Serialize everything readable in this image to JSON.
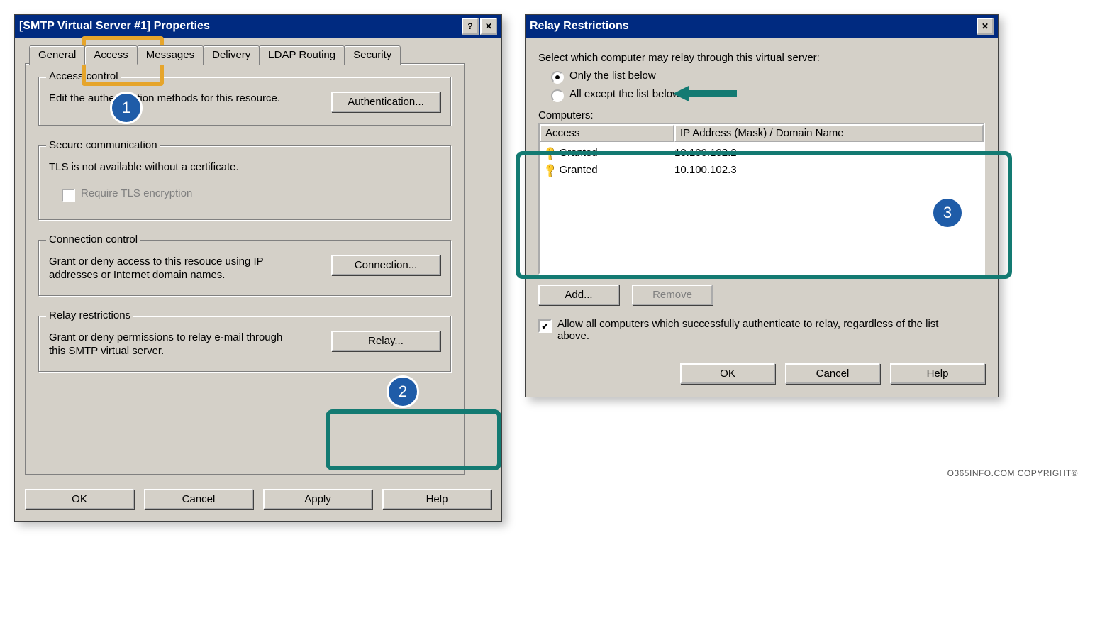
{
  "left": {
    "title": "[SMTP Virtual Server #1] Properties",
    "tabs": [
      "General",
      "Access",
      "Messages",
      "Delivery",
      "LDAP Routing",
      "Security"
    ],
    "access_control": {
      "legend": "Access control",
      "desc": "Edit the authentication methods for this resource.",
      "btn": "Authentication..."
    },
    "secure_comm": {
      "legend": "Secure communication",
      "desc": "TLS is not available without a certificate.",
      "chk": "Require TLS encryption"
    },
    "conn_control": {
      "legend": "Connection control",
      "desc": "Grant or deny access to this resouce using IP addresses or Internet domain names.",
      "btn": "Connection..."
    },
    "relay": {
      "legend": "Relay restrictions",
      "desc": "Grant or deny permissions to relay e-mail through this SMTP virtual server.",
      "btn": "Relay..."
    },
    "buttons": {
      "ok": "OK",
      "cancel": "Cancel",
      "apply": "Apply",
      "help": "Help"
    }
  },
  "right": {
    "title": "Relay Restrictions",
    "intro": "Select which computer may relay through this virtual server:",
    "radio1": "Only the list below",
    "radio2": "All except the list below",
    "list_label": "Computers:",
    "cols": {
      "access": "Access",
      "ip": "IP Address (Mask) / Domain Name"
    },
    "rows": [
      {
        "access": "Granted",
        "ip": "10.100.102.2"
      },
      {
        "access": "Granted",
        "ip": "10.100.102.3"
      }
    ],
    "add": "Add...",
    "remove": "Remove",
    "chk_allow": "Allow all computers which successfully authenticate to relay, regardless of the list above.",
    "buttons": {
      "ok": "OK",
      "cancel": "Cancel",
      "help": "Help"
    }
  },
  "copyright": "O365INFO.COM COPYRIGHT©"
}
